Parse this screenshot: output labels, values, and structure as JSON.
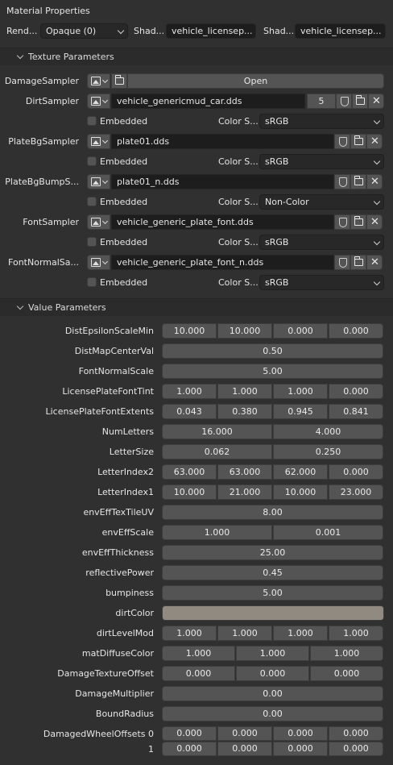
{
  "header": {
    "title": "Material Properties",
    "render_label": "Rend...",
    "render_value": "Opaque (0)",
    "shader_label_1": "Shad...",
    "shader_value_1": "vehicle_licensep...",
    "shader_label_2": "Shad...",
    "shader_value_2": "vehicle_licensep..."
  },
  "texture_panel": {
    "title": "Texture Parameters",
    "open_label": "Open",
    "embedded_label": "Embedded",
    "color_space_label": "Color S...",
    "samplers": [
      {
        "name": "DamageSampler"
      },
      {
        "name": "DirtSampler",
        "file": "vehicle_genericmud_car.dds",
        "count": "5",
        "color_space": "sRGB"
      },
      {
        "name": "PlateBgSampler",
        "file": "plate01.dds",
        "color_space": "sRGB"
      },
      {
        "name": "PlateBgBumpS...",
        "file": "plate01_n.dds",
        "color_space": "Non-Color"
      },
      {
        "name": "FontSampler",
        "file": "vehicle_generic_plate_font.dds",
        "color_space": "sRGB"
      },
      {
        "name": "FontNormalSa...",
        "file": "vehicle_generic_plate_font_n.dds",
        "color_space": "sRGB"
      }
    ]
  },
  "value_panel": {
    "title": "Value Parameters",
    "params": [
      {
        "name": "DistEpsilonScaleMin",
        "values": [
          "10.000",
          "10.000",
          "0.000",
          "0.000"
        ]
      },
      {
        "name": "DistMapCenterVal",
        "values": [
          "0.50"
        ]
      },
      {
        "name": "FontNormalScale",
        "values": [
          "5.00"
        ]
      },
      {
        "name": "LicensePlateFontTint",
        "values": [
          "1.000",
          "1.000",
          "1.000",
          "0.000"
        ]
      },
      {
        "name": "LicensePlateFontExtents",
        "values": [
          "0.043",
          "0.380",
          "0.945",
          "0.841"
        ]
      },
      {
        "name": "NumLetters",
        "values": [
          "16.000",
          "4.000"
        ]
      },
      {
        "name": "LetterSize",
        "values": [
          "0.062",
          "0.250"
        ]
      },
      {
        "name": "LetterIndex2",
        "values": [
          "63.000",
          "63.000",
          "62.000",
          "0.000"
        ]
      },
      {
        "name": "LetterIndex1",
        "values": [
          "10.000",
          "21.000",
          "10.000",
          "23.000"
        ]
      },
      {
        "name": "envEffTexTileUV",
        "values": [
          "8.00"
        ]
      },
      {
        "name": "envEffScale",
        "values": [
          "1.000",
          "0.001"
        ]
      },
      {
        "name": "envEffThickness",
        "values": [
          "25.00"
        ]
      },
      {
        "name": "reflectivePower",
        "values": [
          "0.45"
        ]
      },
      {
        "name": "bumpiness",
        "values": [
          "5.00"
        ]
      },
      {
        "name": "dirtColor",
        "values": []
      },
      {
        "name": "dirtLevelMod",
        "values": [
          "1.000",
          "1.000",
          "1.000",
          "1.000"
        ]
      },
      {
        "name": "matDiffuseColor",
        "values": [
          "1.000",
          "1.000",
          "1.000"
        ]
      },
      {
        "name": "DamageTextureOffset",
        "values": [
          "0.000",
          "0.000",
          "0.000"
        ]
      },
      {
        "name": "DamageMultiplier",
        "values": [
          "0.00"
        ]
      },
      {
        "name": "BoundRadius",
        "values": [
          "0.00"
        ]
      },
      {
        "name": "DamagedWheelOffsets 0",
        "values": [
          "0.000",
          "0.000",
          "0.000",
          "0.000"
        ]
      },
      {
        "name": "1",
        "values": [
          "0.000",
          "0.000",
          "0.000",
          "0.000"
        ]
      }
    ],
    "dirt_color_hex": "#908a80"
  }
}
